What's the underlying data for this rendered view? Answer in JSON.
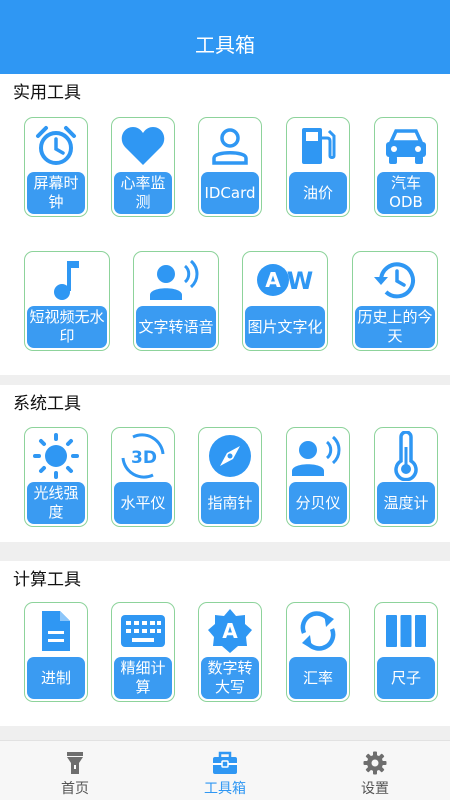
{
  "header": {
    "title": "工具箱"
  },
  "sections": [
    {
      "title": "实用工具",
      "tools": [
        {
          "label": "屏幕时钟",
          "icon": "alarm-clock-icon"
        },
        {
          "label": "心率监测",
          "icon": "heart-icon"
        },
        {
          "label": "IDCard",
          "icon": "person-icon"
        },
        {
          "label": "油价",
          "icon": "gas-pump-icon"
        },
        {
          "label": "汽车ODB",
          "icon": "car-icon"
        },
        {
          "label": "短视频无水印",
          "icon": "music-note-icon"
        },
        {
          "label": "文字转语音",
          "icon": "voice-icon"
        },
        {
          "label": "图片文字化",
          "icon": "text-aw-icon"
        },
        {
          "label": "历史上的今天",
          "icon": "history-icon"
        }
      ]
    },
    {
      "title": "系统工具",
      "tools": [
        {
          "label": "光线强度",
          "icon": "sun-icon"
        },
        {
          "label": "水平仪",
          "icon": "3d-rotation-icon"
        },
        {
          "label": "指南针",
          "icon": "compass-icon"
        },
        {
          "label": "分贝仪",
          "icon": "decibel-icon"
        },
        {
          "label": "温度计",
          "icon": "thermometer-icon"
        }
      ]
    },
    {
      "title": "计算工具",
      "tools": [
        {
          "label": "进制",
          "icon": "document-icon"
        },
        {
          "label": "精细计算",
          "icon": "keyboard-icon"
        },
        {
          "label": "数字转大写",
          "icon": "letter-a-badge-icon"
        },
        {
          "label": "汇率",
          "icon": "refresh-icon"
        },
        {
          "label": "尺子",
          "icon": "ruler-icon"
        }
      ]
    }
  ],
  "nav": [
    {
      "label": "首页",
      "icon": "flashlight-icon",
      "active": false
    },
    {
      "label": "工具箱",
      "icon": "toolbox-icon",
      "active": true
    },
    {
      "label": "设置",
      "icon": "gear-icon",
      "active": false
    }
  ],
  "colors": {
    "primary": "#2f97f3",
    "tile_border": "#8dd39b",
    "background": "#efefef"
  }
}
